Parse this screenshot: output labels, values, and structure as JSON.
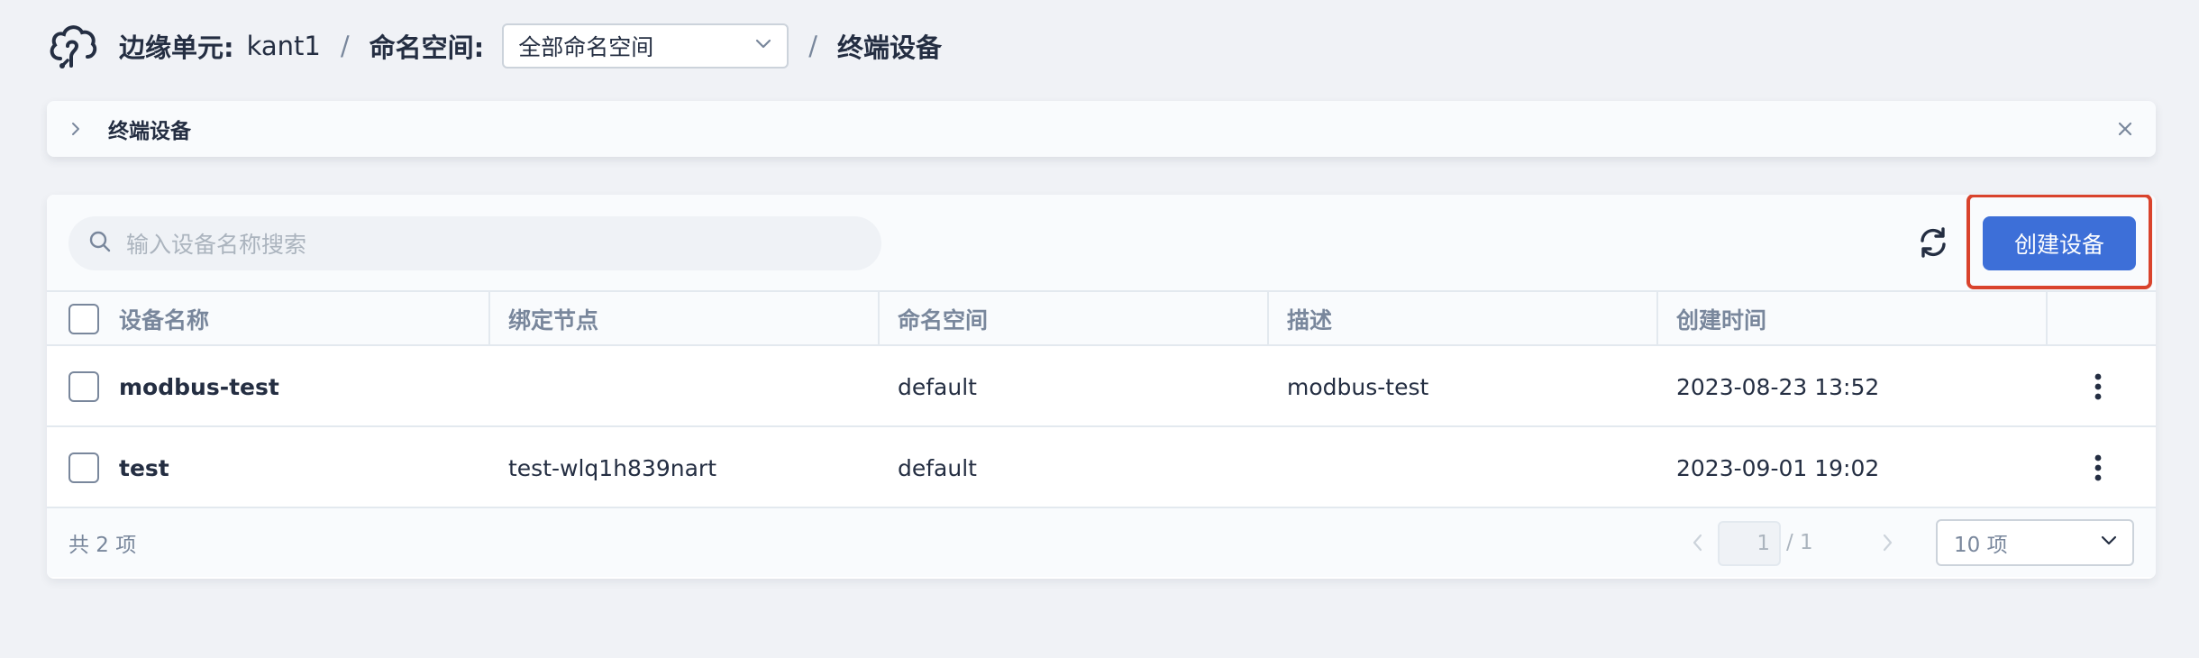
{
  "header": {
    "logo_icon": "cloud-logo-icon",
    "edge_unit_label": "边缘单元:",
    "edge_unit_value": "kant1",
    "sep1": "/",
    "namespace_label": "命名空间:",
    "namespace_selected": "全部命名空间",
    "sep2": "/",
    "current_page": "终端设备"
  },
  "banner": {
    "title": "终端设备"
  },
  "toolbar": {
    "search_placeholder": "输入设备名称搜索",
    "create_label": "创建设备"
  },
  "table": {
    "columns": [
      "设备名称",
      "绑定节点",
      "命名空间",
      "描述",
      "创建时间"
    ],
    "rows": [
      {
        "name": "modbus-test",
        "node": "",
        "namespace": "default",
        "description": "modbus-test",
        "created": "2023-08-23 13:52"
      },
      {
        "name": "test",
        "node": "test-wlq1h839nart",
        "namespace": "default",
        "description": "",
        "created": "2023-09-01 19:02"
      }
    ]
  },
  "footer": {
    "total": "共 2 项",
    "current_page": "1",
    "page_total": "/ 1",
    "page_size": "10 项"
  },
  "colors": {
    "primary": "#3d6fd8",
    "highlight": "#d9432c",
    "background": "#f0f2f6"
  }
}
